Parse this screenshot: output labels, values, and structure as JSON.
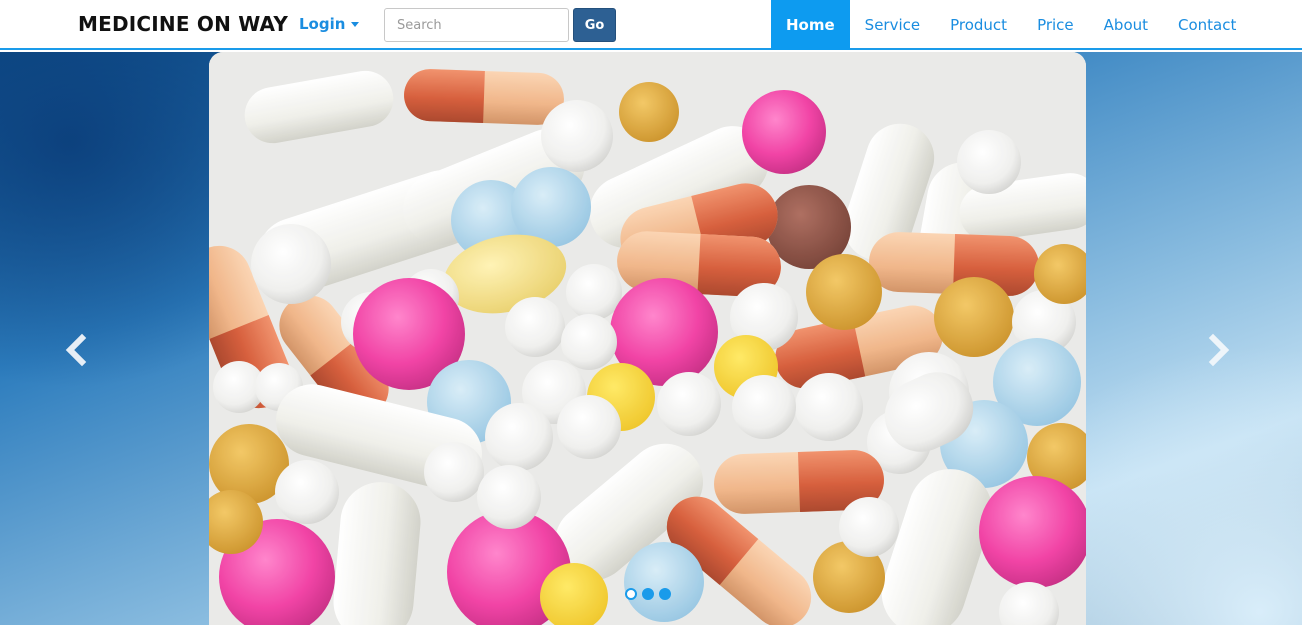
{
  "navbar": {
    "brand": "MEDICINE ON WAY",
    "login_label": "Login",
    "search_placeholder": "Search",
    "go_label": "Go",
    "items": [
      {
        "label": "Home",
        "active": true
      },
      {
        "label": "Service",
        "active": false
      },
      {
        "label": "Product",
        "active": false
      },
      {
        "label": "Price",
        "active": false
      },
      {
        "label": "About",
        "active": false
      },
      {
        "label": "Contact",
        "active": false
      }
    ]
  },
  "carousel": {
    "slide_count": 3,
    "active_index": 0,
    "prev_icon": "chevron-left-icon",
    "next_icon": "chevron-right-icon"
  },
  "colors": {
    "accent": "#1a9bea",
    "link": "#1a8de0",
    "go_button": "#2d6093",
    "pill_pink": "#f0349e",
    "pill_red": "#d4532e",
    "pill_yellow": "#f2dc7a",
    "pill_blue": "#a9d3ea",
    "pill_mustard": "#dca42e"
  }
}
